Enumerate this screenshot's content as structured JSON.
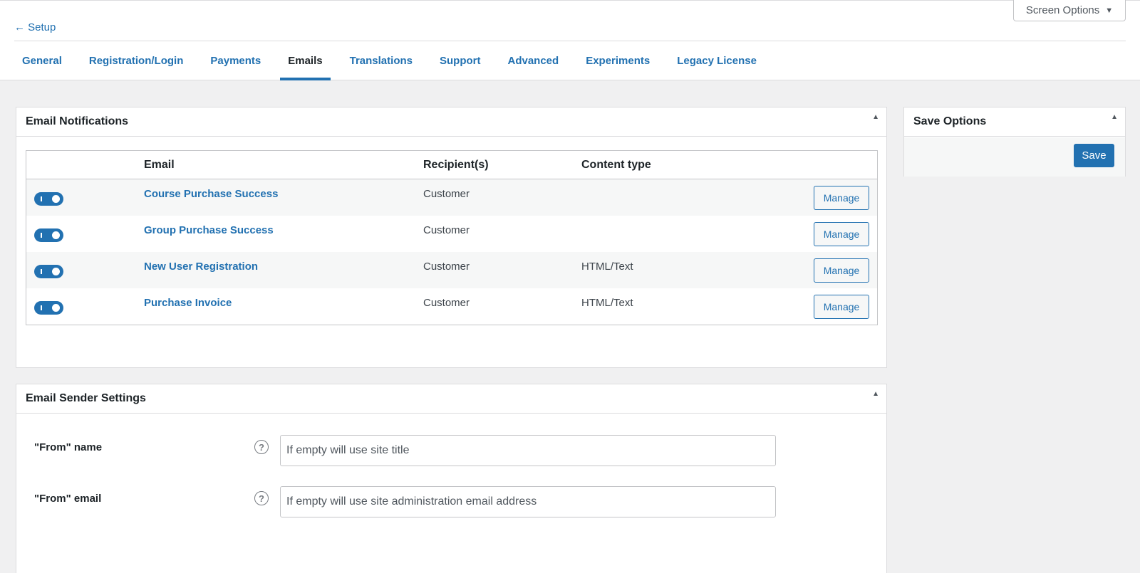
{
  "header": {
    "screen_options": "Screen Options",
    "back_link": "← Setup"
  },
  "tabs": [
    {
      "label": "General"
    },
    {
      "label": "Registration/Login"
    },
    {
      "label": "Payments"
    },
    {
      "label": "Emails",
      "active": true
    },
    {
      "label": "Translations"
    },
    {
      "label": "Support"
    },
    {
      "label": "Advanced"
    },
    {
      "label": "Experiments"
    },
    {
      "label": "Legacy License"
    }
  ],
  "notifications": {
    "title": "Email Notifications",
    "columns": {
      "email": "Email",
      "recipients": "Recipient(s)",
      "content_type": "Content type"
    },
    "rows": [
      {
        "enabled": true,
        "email": "Course Purchase Success",
        "recipients": "Customer",
        "content_type": "",
        "action": "Manage"
      },
      {
        "enabled": true,
        "email": "Group Purchase Success",
        "recipients": "Customer",
        "content_type": "",
        "action": "Manage"
      },
      {
        "enabled": true,
        "email": "New User Registration",
        "recipients": "Customer",
        "content_type": "HTML/Text",
        "action": "Manage"
      },
      {
        "enabled": true,
        "email": "Purchase Invoice",
        "recipients": "Customer",
        "content_type": "HTML/Text",
        "action": "Manage"
      }
    ]
  },
  "sender": {
    "title": "Email Sender Settings",
    "from_name": {
      "label": "\"From\" name",
      "value": "",
      "placeholder": "If empty will use site title"
    },
    "from_email": {
      "label": "\"From\" email",
      "value": "",
      "placeholder": "If empty will use site administration email address"
    }
  },
  "save_options": {
    "title": "Save Options",
    "save_label": "Save"
  },
  "colors": {
    "accent": "#2271b1",
    "background": "#f0f0f1"
  }
}
